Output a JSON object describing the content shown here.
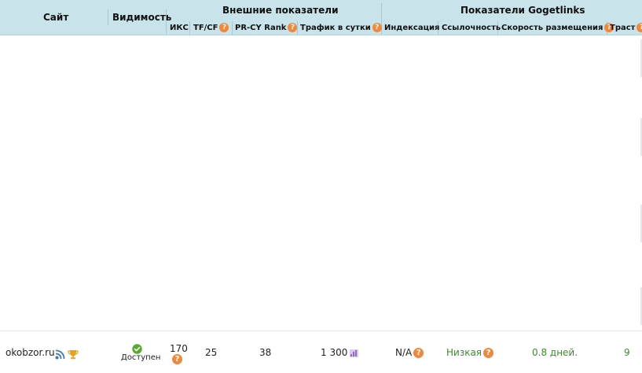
{
  "header": {
    "site": "Сайт",
    "visibility": "Видимость",
    "external_group": "Внешние показатели",
    "gogetlinks_group": "Показатели Gogetlinks",
    "cols": {
      "iks": "ИКС",
      "tfcf": "TF/CF",
      "prcy": "PR-CY Rank",
      "traffic": "Трафик в сутки",
      "indexing": "Индексация",
      "linkage": "Ссылочность",
      "speed": "Скорость размещения",
      "trust": "Траст"
    },
    "help_glyph": "?"
  },
  "row": {
    "site": "okobzor.ru",
    "status": "Доступен",
    "iks": "170",
    "tfcf": "25",
    "prcy": "38",
    "traffic": "1 300",
    "indexing": "N/A",
    "linkage": "Низкая",
    "speed": "0.8 дней.",
    "trust": "9"
  },
  "colors": {
    "header_bg": "#c9e3ea",
    "help_icon": "#f0883a",
    "rss_icon": "#3a79b8",
    "trophy_icon": "#e8a317",
    "status_ok": "#5aa832",
    "green_text": "#3c8d2f",
    "traffic_chart_icon": "#8f6bd1"
  },
  "icons": [
    "help-icon",
    "rss-icon",
    "trophy-icon",
    "status-ok-icon",
    "traffic-chart-icon"
  ]
}
